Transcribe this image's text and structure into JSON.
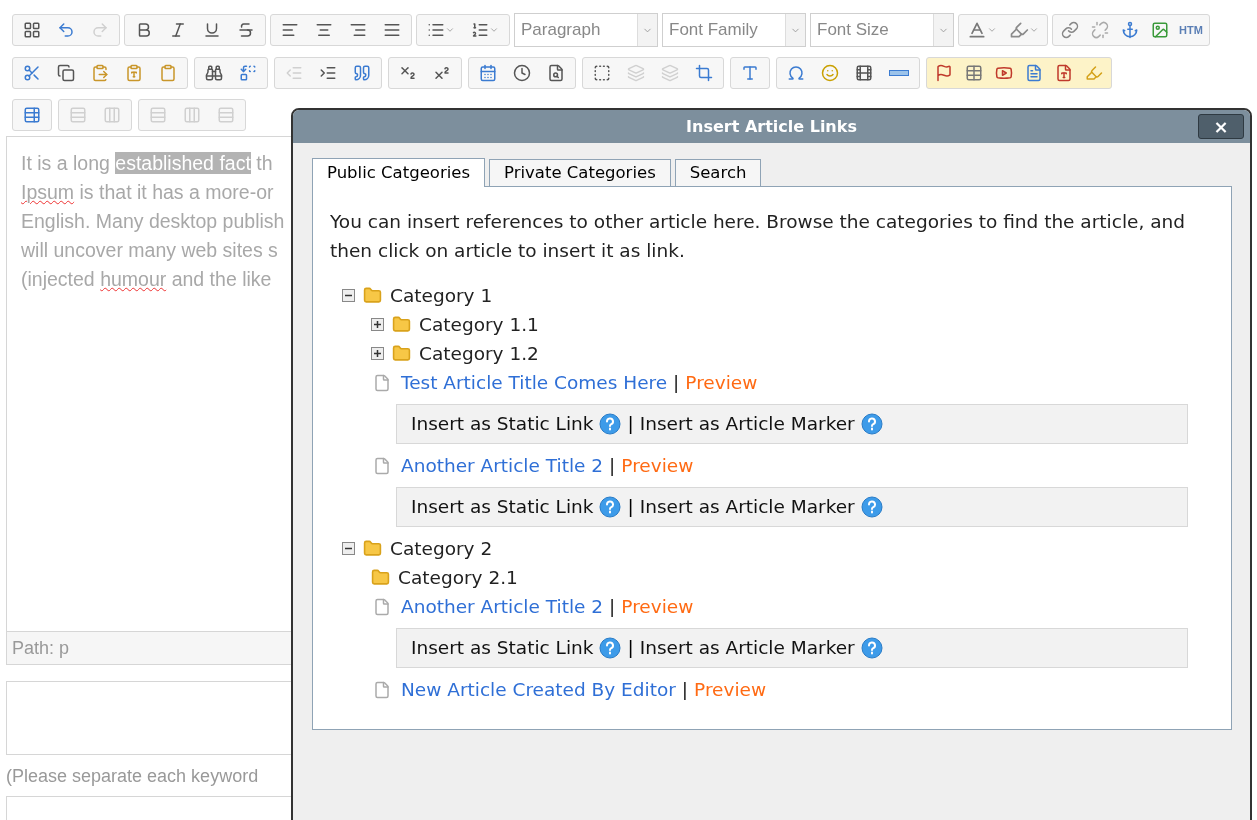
{
  "toolbar": {
    "rows": [
      {
        "buttons": [
          {
            "disabled": false
          },
          {
            "disabled": false
          },
          {
            "disabled": true
          },
          {
            "disabled": false
          },
          {
            "disabled": false
          },
          {
            "disabled": false
          },
          {
            "disabled": false
          },
          {
            "disabled": false
          },
          {
            "disabled": false
          },
          {
            "disabled": false
          },
          {
            "disabled": false
          },
          {
            "disabled": false
          },
          {
            "disabled": false
          }
        ]
      },
      {
        "buttons": [
          {
            "disabled": false
          },
          {
            "disabled": false
          },
          {
            "disabled": false
          },
          {
            "disabled": false
          },
          {
            "disabled": false
          },
          {
            "disabled": false
          },
          {
            "disabled": false
          },
          {
            "disabled": true
          },
          {
            "disabled": false
          },
          {
            "disabled": false
          },
          {
            "disabled": false
          },
          {
            "disabled": false
          },
          {
            "disabled": false
          },
          {
            "disabled": false
          },
          {
            "disabled": false
          },
          {
            "disabled": false
          },
          {
            "disabled": true
          },
          {
            "disabled": true
          },
          {
            "disabled": false
          },
          {
            "disabled": false
          },
          {
            "disabled": false
          },
          {
            "disabled": false
          },
          {
            "disabled": false
          },
          {
            "disabled": false
          }
        ]
      },
      {
        "buttons": [
          {
            "disabled": false
          },
          {
            "disabled": true
          },
          {
            "disabled": true
          },
          {
            "disabled": true
          },
          {
            "disabled": true
          },
          {
            "disabled": true
          }
        ]
      }
    ],
    "selects": [
      "Paragraph",
      "Font Family",
      "Font Size"
    ],
    "html_button": "HTM"
  },
  "editor": {
    "lines": [
      [
        {
          "text": "It is a long ",
          "selected": false,
          "misspelled": false
        },
        {
          "text": "established fact",
          "selected": true,
          "misspelled": false
        },
        {
          "text": " th",
          "selected": false,
          "misspelled": false
        }
      ],
      [
        {
          "text": "Ipsum",
          "selected": false,
          "misspelled": true
        },
        {
          "text": " is that it has a more-or",
          "selected": false,
          "misspelled": false
        }
      ],
      [
        {
          "text": "English. Many desktop publish",
          "selected": false,
          "misspelled": false
        }
      ],
      [
        {
          "text": "will uncover many web sites s",
          "selected": false,
          "misspelled": false
        }
      ],
      [
        {
          "text": "(injected ",
          "selected": false,
          "misspelled": false
        },
        {
          "text": "humour",
          "selected": false,
          "misspelled": true
        },
        {
          "text": " and the like",
          "selected": false,
          "misspelled": false
        }
      ]
    ],
    "path": "Path: p"
  },
  "keywords_hint": "(Please separate each keyword",
  "dialog": {
    "title": "Insert Article Links",
    "close": "×",
    "tabs": [
      {
        "label": "Public Catgeories",
        "selected": true
      },
      {
        "label": "Private Categories",
        "selected": false
      },
      {
        "label": "Search",
        "selected": false
      }
    ],
    "intro": "You can insert references to other article here. Browse the categories to find the article, and then click on article to insert it as link.",
    "tree": [
      {
        "kind": "category",
        "label": "Category 1",
        "expanded": true,
        "children": [
          {
            "kind": "category",
            "label": "Category 1.1",
            "expanded": false
          },
          {
            "kind": "category",
            "label": "Category 1.2",
            "expanded": false
          },
          {
            "kind": "article",
            "title": "Test Article Title Comes Here",
            "separator": "|",
            "preview": "Preview",
            "actions": [
              "Insert as Static Link",
              "Insert as Article Marker"
            ],
            "action_separator": "|"
          },
          {
            "kind": "article",
            "title": "Another Article Title 2",
            "separator": "|",
            "preview": "Preview",
            "actions": [
              "Insert as Static Link",
              "Insert as Article Marker"
            ],
            "action_separator": "|"
          }
        ]
      },
      {
        "kind": "category",
        "label": "Category 2",
        "expanded": true,
        "children": [
          {
            "kind": "category",
            "label": "Category 2.1"
          },
          {
            "kind": "article",
            "title": "Another Article Title 2",
            "separator": "|",
            "preview": "Preview",
            "actions": [
              "Insert as Static Link",
              "Insert as Article Marker"
            ],
            "action_separator": "|"
          },
          {
            "kind": "article",
            "title": "New Article Created By Editor",
            "separator": "|",
            "preview": "Preview"
          }
        ]
      }
    ]
  }
}
